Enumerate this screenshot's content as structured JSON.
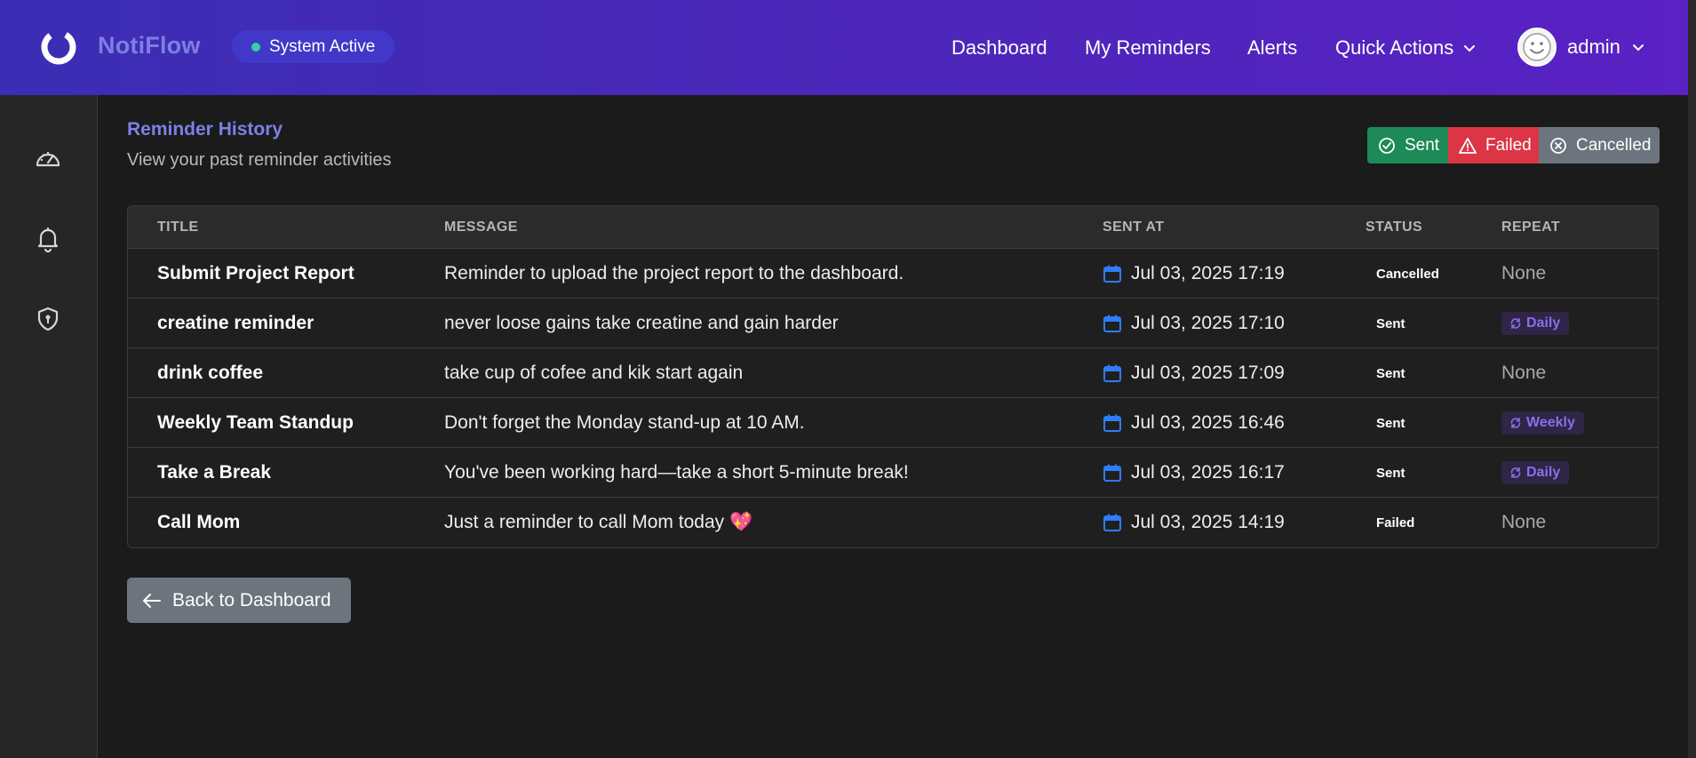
{
  "navbar": {
    "brand": "NotiFlow",
    "system_status": "System Active",
    "links": [
      "Dashboard",
      "My Reminders",
      "Alerts",
      "Quick Actions"
    ],
    "user": "admin",
    "colors": {
      "brand": "#7d7fe2",
      "status_dot": "#2fd3a0"
    }
  },
  "sidebar": {
    "icons": [
      "dashboard-gauge-icon",
      "bell-icon",
      "shield-icon"
    ]
  },
  "page": {
    "title": "Reminder History",
    "subtitle": "View your past reminder activities"
  },
  "legend": {
    "sent": "Sent",
    "failed": "Failed",
    "cancelled": "Cancelled"
  },
  "table": {
    "headers": [
      "TITLE",
      "MESSAGE",
      "SENT AT",
      "STATUS",
      "REPEAT"
    ],
    "rows": [
      {
        "title": "Submit Project Report",
        "message": "Reminder to upload the project report to the dashboard.",
        "sent_at": "Jul 03, 2025 17:19",
        "status": "Cancelled",
        "repeat": "None"
      },
      {
        "title": "creatine reminder",
        "message": "never loose gains take creatine and gain harder",
        "sent_at": "Jul 03, 2025 17:10",
        "status": "Sent",
        "repeat": "Daily"
      },
      {
        "title": "drink coffee",
        "message": "take cup of cofee and kik start again",
        "sent_at": "Jul 03, 2025 17:09",
        "status": "Sent",
        "repeat": "None"
      },
      {
        "title": "Weekly Team Standup",
        "message": "Don't forget the Monday stand-up at 10 AM.",
        "sent_at": "Jul 03, 2025 16:46",
        "status": "Sent",
        "repeat": "Weekly"
      },
      {
        "title": "Take a Break",
        "message": "You've been working hard—take a short 5-minute break!",
        "sent_at": "Jul 03, 2025 16:17",
        "status": "Sent",
        "repeat": "Daily"
      },
      {
        "title": "Call Mom",
        "message": "Just a reminder to call Mom today 💖",
        "sent_at": "Jul 03, 2025 14:19",
        "status": "Failed",
        "repeat": "None"
      }
    ]
  },
  "back_button": "Back to Dashboard"
}
